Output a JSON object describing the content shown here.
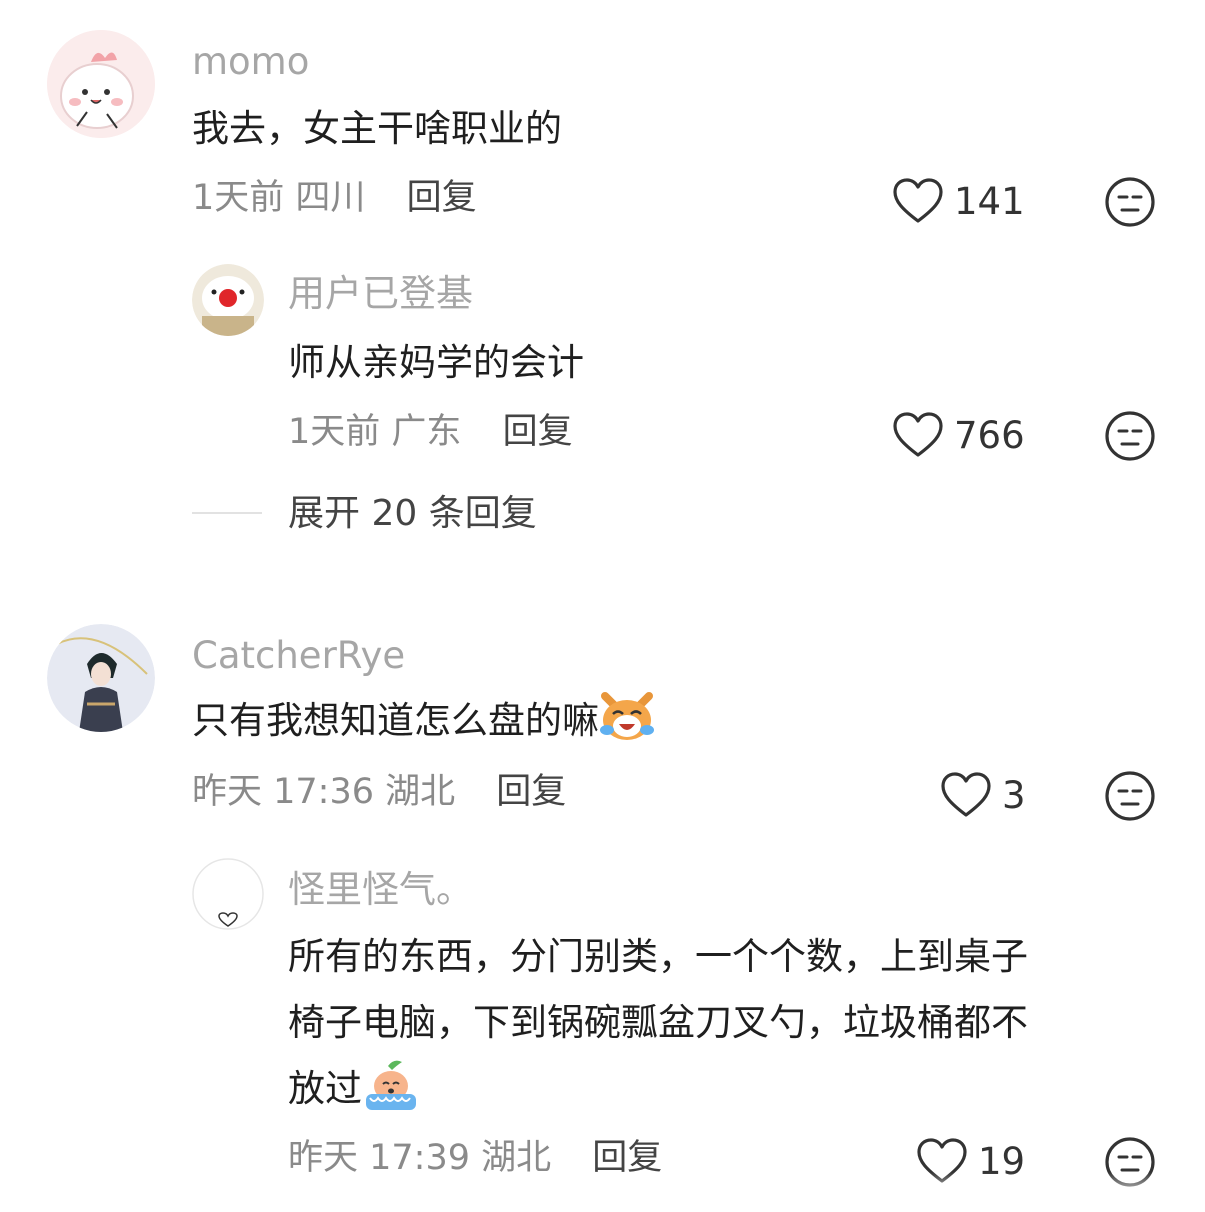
{
  "comments": [
    {
      "username": "momo",
      "text": "我去，女主干啥职业的",
      "time": "1天前",
      "location": "四川",
      "reply_label": "回复",
      "likes": "141",
      "replies": [
        {
          "username": "用户已登基",
          "text": "师从亲妈学的会计",
          "time": "1天前",
          "location": "广东",
          "reply_label": "回复",
          "likes": "766"
        }
      ],
      "expand_label": "展开 20 条回复"
    },
    {
      "username": "CatcherRye",
      "text": "只有我想知道怎么盘的嘛",
      "time": "昨天 17:36",
      "location": "湖北",
      "reply_label": "回复",
      "likes": "3",
      "replies": [
        {
          "username": "怪里怪气。",
          "text_lines": [
            "所有的东西，分门别类，一个个数，上到桌子",
            "椅子电脑，下到锅碗瓢盆刀叉勺，垃圾桶都不",
            "放过"
          ],
          "time": "昨天 17:39",
          "location": "湖北",
          "reply_label": "回复",
          "likes": "19"
        }
      ]
    }
  ],
  "icons": {
    "like": "heart-outline-icon",
    "dislike": "unamused-face-icon",
    "emoji_1": "laughing-crying-cat-emoji",
    "emoji_2": "crying-peach-emoji"
  },
  "colors": {
    "username": "#a6a6a6",
    "meta": "#8a8a8a",
    "text": "#1f1f1f"
  }
}
